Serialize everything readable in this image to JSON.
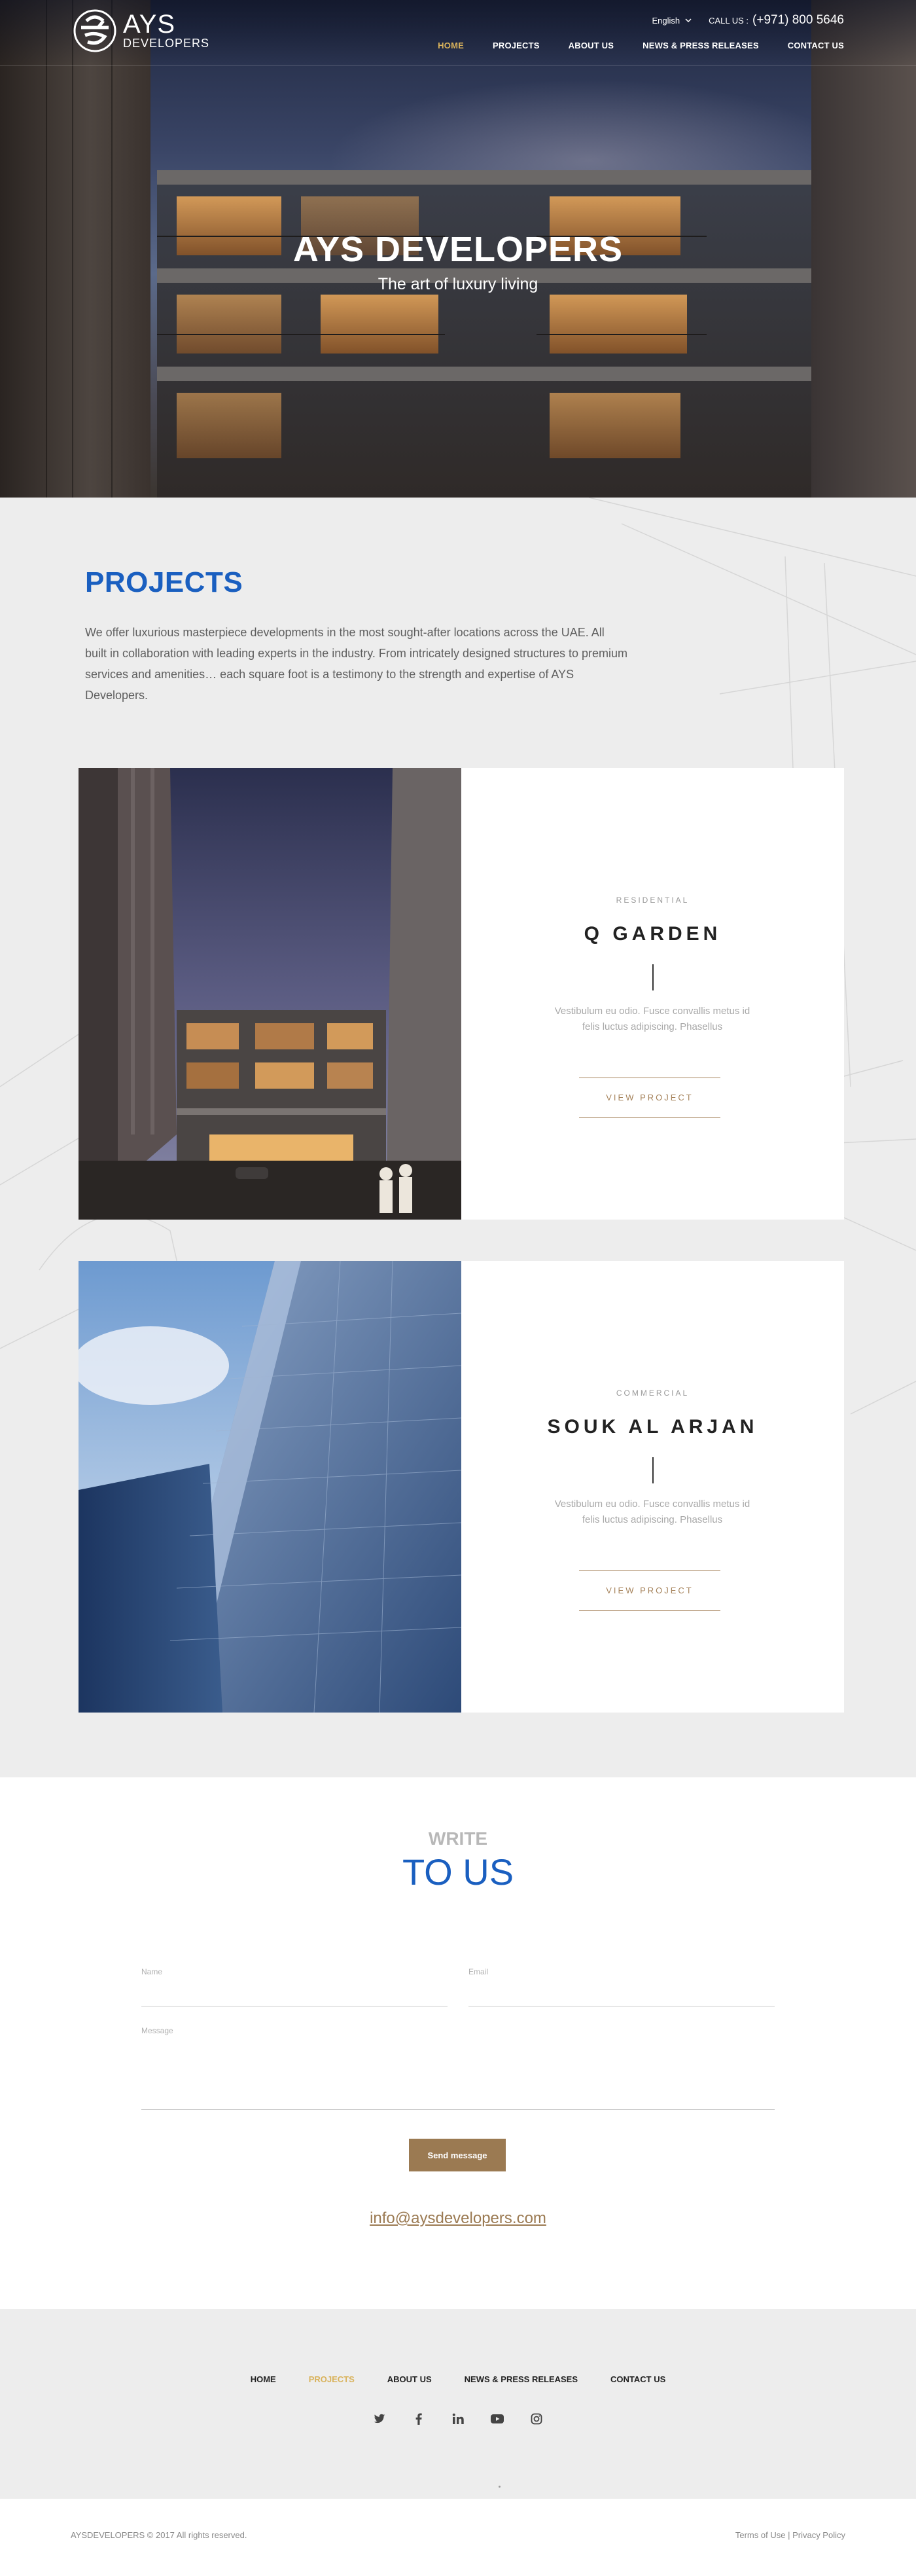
{
  "header": {
    "logo_line1": "AYS",
    "logo_line2": "DEVELOPERS",
    "language": "English",
    "call_label": "CALL US :",
    "call_number": "(+971) 800 5646",
    "nav": [
      {
        "label": "HOME",
        "active": true
      },
      {
        "label": "PROJECTS",
        "active": false
      },
      {
        "label": "ABOUT US",
        "active": false
      },
      {
        "label": "NEWS & PRESS RELEASES",
        "active": false
      },
      {
        "label": "CONTACT US",
        "active": false
      }
    ]
  },
  "hero": {
    "title": "AYS DEVELOPERS",
    "subtitle": "The art of luxury living"
  },
  "projects": {
    "heading": "PROJECTS",
    "description": "We offer luxurious masterpiece developments in the most sought-after locations across the UAE. All built in collaboration with leading experts in the industry. From intricately designed structures to premium services and amenities… each square foot is a testimony to the strength and expertise of AYS Developers.",
    "items": [
      {
        "category": "RESIDENTIAL",
        "name": "Q GARDEN",
        "text": "Vestibulum eu odio. Fusce convallis metus id felis luctus adipiscing. Phasellus",
        "button": "VIEW PROJECT"
      },
      {
        "category": "COMMERCIAL",
        "name": "SOUK AL ARJAN",
        "text": "Vestibulum eu odio. Fusce convallis metus id felis luctus adipiscing. Phasellus",
        "button": "VIEW PROJECT"
      }
    ]
  },
  "contact": {
    "heading_small": "WRITE",
    "heading_big": "TO US",
    "name_label": "Name",
    "email_label": "Email",
    "message_label": "Message",
    "send_label": "Send message",
    "email_link": "info@aysdevelopers.com"
  },
  "footer": {
    "nav": [
      {
        "label": "HOME",
        "active": false
      },
      {
        "label": "PROJECTS",
        "active": true
      },
      {
        "label": "ABOUT US",
        "active": false
      },
      {
        "label": "NEWS & PRESS RELEASES",
        "active": false
      },
      {
        "label": "CONTACT US",
        "active": false
      }
    ],
    "social_icons": [
      "twitter-icon",
      "facebook-icon",
      "linkedin-icon",
      "youtube-icon",
      "instagram-icon"
    ],
    "copyright": "AYSDEVELOPERS © 2017 All rights reserved.",
    "terms": "Terms of Use",
    "separator": "|",
    "privacy": "Privacy Policy"
  },
  "colors": {
    "accent_blue": "#1a5fc0",
    "accent_gold": "#d9b25b",
    "button_brown": "#9b7a52"
  }
}
